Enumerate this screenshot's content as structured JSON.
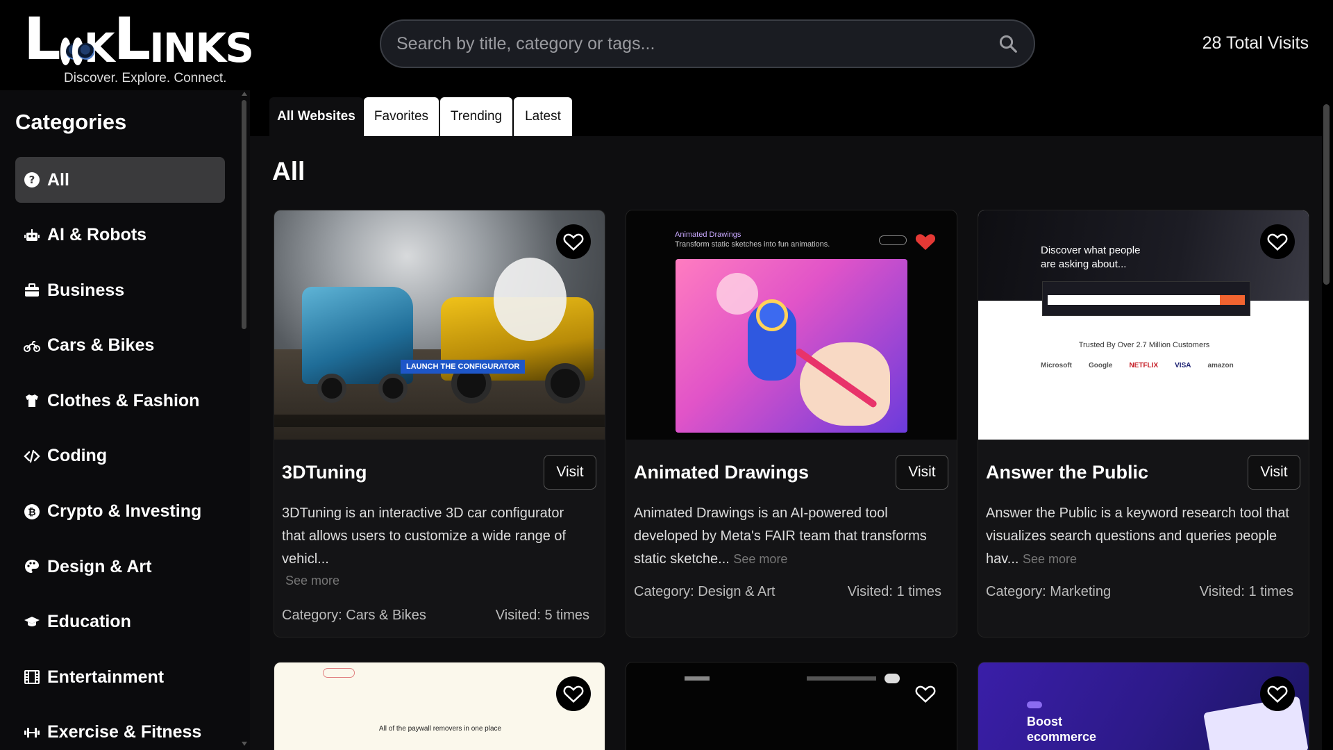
{
  "app": {
    "logo_text": "LookLinks",
    "tagline": "Discover. Explore. Connect.",
    "total_visits": "28 Total Visits"
  },
  "search": {
    "placeholder": "Search by title, category or tags..."
  },
  "sidebar": {
    "title": "Categories",
    "items": [
      {
        "label": "All",
        "icon": "question-circle-icon",
        "active": true
      },
      {
        "label": "AI & Robots",
        "icon": "robot-icon"
      },
      {
        "label": "Business",
        "icon": "briefcase-icon"
      },
      {
        "label": "Cars & Bikes",
        "icon": "motorcycle-icon"
      },
      {
        "label": "Clothes & Fashion",
        "icon": "shirt-icon"
      },
      {
        "label": "Coding",
        "icon": "code-icon"
      },
      {
        "label": "Crypto & Investing",
        "icon": "bitcoin-icon"
      },
      {
        "label": "Design & Art",
        "icon": "palette-icon"
      },
      {
        "label": "Education",
        "icon": "graduation-cap-icon"
      },
      {
        "label": "Entertainment",
        "icon": "film-icon"
      },
      {
        "label": "Exercise & Fitness",
        "icon": "dumbbell-icon"
      }
    ]
  },
  "tabs": [
    {
      "label": "All Websites",
      "active": true
    },
    {
      "label": "Favorites"
    },
    {
      "label": "Trending"
    },
    {
      "label": "Latest"
    }
  ],
  "main": {
    "section_title": "All"
  },
  "cards": [
    {
      "title": "3DTuning",
      "visit_label": "Visit",
      "description": "3DTuning is an interactive 3D car configurator that allows users to customize a wide range of vehicl...",
      "see_more": "See more",
      "category": "Category: Cars & Bikes",
      "visited": "Visited: 5 times",
      "favorited": false,
      "thumb_text": "LAUNCH THE CONFIGURATOR"
    },
    {
      "title": "Animated Drawings",
      "visit_label": "Visit",
      "description": "Animated Drawings is an AI-powered tool developed by Meta's FAIR team that transforms static sketche...",
      "see_more": "See more",
      "category": "Category: Design & Art",
      "visited": "Visited: 1 times",
      "favorited": true,
      "thumb_title": "Animated Drawings",
      "thumb_sub": "Transform static sketches into fun animations."
    },
    {
      "title": "Answer the Public",
      "visit_label": "Visit",
      "description": "Answer the Public is a keyword research tool that visualizes search questions and queries people hav...",
      "see_more": "See more",
      "category": "Category: Marketing",
      "visited": "Visited: 1 times",
      "favorited": false,
      "thumb_headline": "Discover what people are asking about...",
      "thumb_trusted": "Trusted By Over 2.7 Million Customers",
      "thumb_brands": [
        "Microsoft",
        "Google",
        "NETFLIX",
        "VISA",
        "amazon"
      ]
    },
    {
      "thumb_text": "All of the paywall removers in one place",
      "favorited": false
    },
    {
      "favorited": false
    },
    {
      "thumb_headline": "Boost ecommerce",
      "favorited": false
    }
  ],
  "colors": {
    "background": "#000000",
    "panel": "#0e0e10",
    "active_category": "#3a3a3c",
    "favorite_red": "#e53935"
  }
}
